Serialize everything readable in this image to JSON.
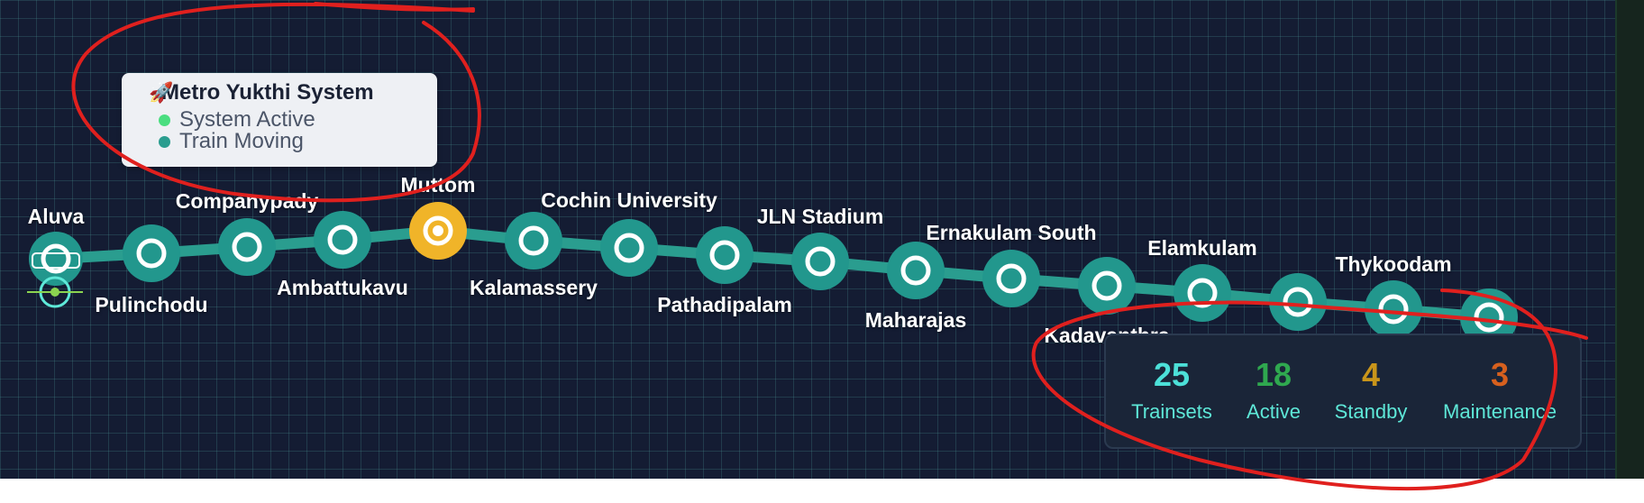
{
  "status_card": {
    "icon": "rocket-icon",
    "title": "Metro Yukthi System",
    "items": [
      {
        "label": "System Active",
        "color": "#4ade80"
      },
      {
        "label": "Train Moving",
        "color": "#2a9d8f"
      }
    ]
  },
  "stations": [
    {
      "name": "Aluva"
    },
    {
      "name": "Pulinchodu"
    },
    {
      "name": "Companypady"
    },
    {
      "name": "Ambattukavu"
    },
    {
      "name": "Muttom"
    },
    {
      "name": "Kalamassery"
    },
    {
      "name": "Cochin University"
    },
    {
      "name": "Pathadipalam"
    },
    {
      "name": "JLN Stadium"
    },
    {
      "name": "Maharajas"
    },
    {
      "name": "Ernakulam South"
    },
    {
      "name": "Kadavanthra"
    },
    {
      "name": "Elamkulam"
    },
    {
      "name": "Thykoodam"
    }
  ],
  "highlighted_station": "Muttom",
  "stats": [
    {
      "value": "25",
      "label": "Trainsets",
      "color": "#4ce0d8"
    },
    {
      "value": "18",
      "label": "Active",
      "color": "#2fa84f"
    },
    {
      "value": "4",
      "label": "Standby",
      "color": "#c9951a"
    },
    {
      "value": "3",
      "label": "Maintenance",
      "color": "#d6601e"
    }
  ],
  "colors": {
    "background": "#141c33",
    "track": "#2a9d8f",
    "station_node": "#22978d",
    "highlight": "#f0b429",
    "annotation": "#e0201e"
  }
}
